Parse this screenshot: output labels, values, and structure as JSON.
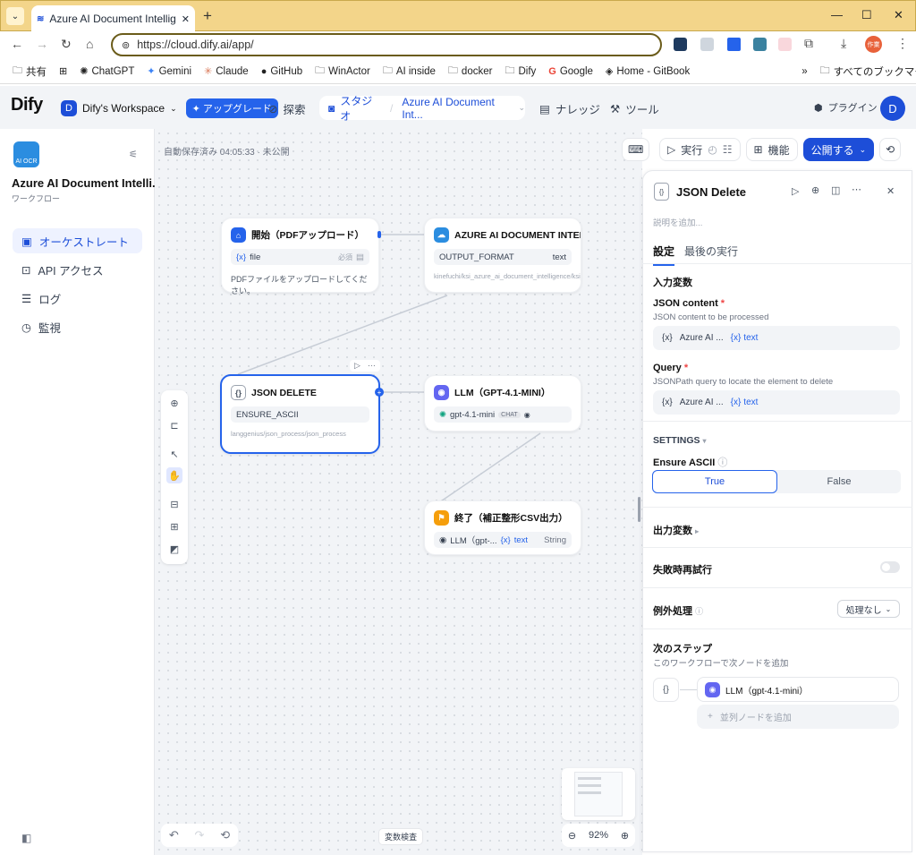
{
  "browser": {
    "tab_title": "Azure AI Document Intelligence",
    "url": "https://cloud.dify.ai/app/",
    "bookmarks": [
      "共有",
      "ChatGPT",
      "Gemini",
      "Claude",
      "GitHub",
      "WinActor",
      "AI inside",
      "docker",
      "Dify",
      "Google",
      "Home - GitBook"
    ],
    "all_bookmarks": "すべてのブックマーク",
    "profile_badge": "作業"
  },
  "header": {
    "logo": "Dify",
    "workspace_initial": "D",
    "workspace": "Dify's Workspace",
    "upgrade": "✦ アップグレード",
    "explore": "探索",
    "studio": "スタジオ",
    "app_crumb": "Azure AI Document Int...",
    "knowledge": "ナレッジ",
    "tools": "ツール",
    "plugins": "プラグイン",
    "avatar": "D"
  },
  "sidebar": {
    "app_icon_text": "AI OCR",
    "app_name": "Azure AI Document Intelli...",
    "app_type": "ワークフロー",
    "items": [
      {
        "label": "オーケストレート"
      },
      {
        "label": "API アクセス"
      },
      {
        "label": "ログ"
      },
      {
        "label": "監視"
      }
    ]
  },
  "canvas": {
    "autosave": "自動保存済み 04:05:33 · 未公開",
    "run": "実行",
    "features": "機能",
    "publish": "公開する",
    "variable_inspect": "変数検査",
    "zoom": "92%"
  },
  "nodes": {
    "start": {
      "title": "開始（PDFアップロード）",
      "var": "file",
      "req": "必須",
      "desc": "PDFファイルをアップロードしてください。"
    },
    "azure": {
      "title": "AZURE AI DOCUMENT INTELLI",
      "param": "OUTPUT_FORMAT",
      "type": "text",
      "path": "kinefuchi/ksi_azure_ai_document_intelligence/ksi_azure_ai_document_in"
    },
    "json": {
      "title": "JSON DELETE",
      "param": "ENSURE_ASCII",
      "path": "langgenius/json_process/json_process"
    },
    "llm": {
      "title": "LLM（GPT-4.1-MINI）",
      "model": "gpt-4.1-mini",
      "mode": "CHAT"
    },
    "end": {
      "title": "終了（補正整形CSV出力）",
      "var_src": "LLM（gpt-...",
      "var": "text",
      "type": "String"
    }
  },
  "panel": {
    "title": "JSON Delete",
    "desc_placeholder": "説明を追加...",
    "tab_settings": "設定",
    "tab_last_run": "最後の実行",
    "input_vars": "入力変数",
    "json_content_label": "JSON content",
    "json_content_desc": "JSON content to be processed",
    "json_content_src": "Azure AI ...",
    "json_content_var": "text",
    "query_label": "Query",
    "query_desc": "JSONPath query to locate the element to delete",
    "query_src": "Azure AI ...",
    "query_var": "text",
    "settings": "SETTINGS",
    "ensure_ascii": "Ensure ASCII",
    "true_label": "True",
    "false_label": "False",
    "output_vars": "出力変数",
    "retry": "失敗時再試行",
    "error_handling": "例外処理",
    "error_value": "処理なし",
    "next_step": "次のステップ",
    "next_step_desc": "このワークフローで次ノードを追加",
    "next_node": "LLM（gpt-4.1-mini）",
    "add_parallel": "並列ノードを追加"
  }
}
